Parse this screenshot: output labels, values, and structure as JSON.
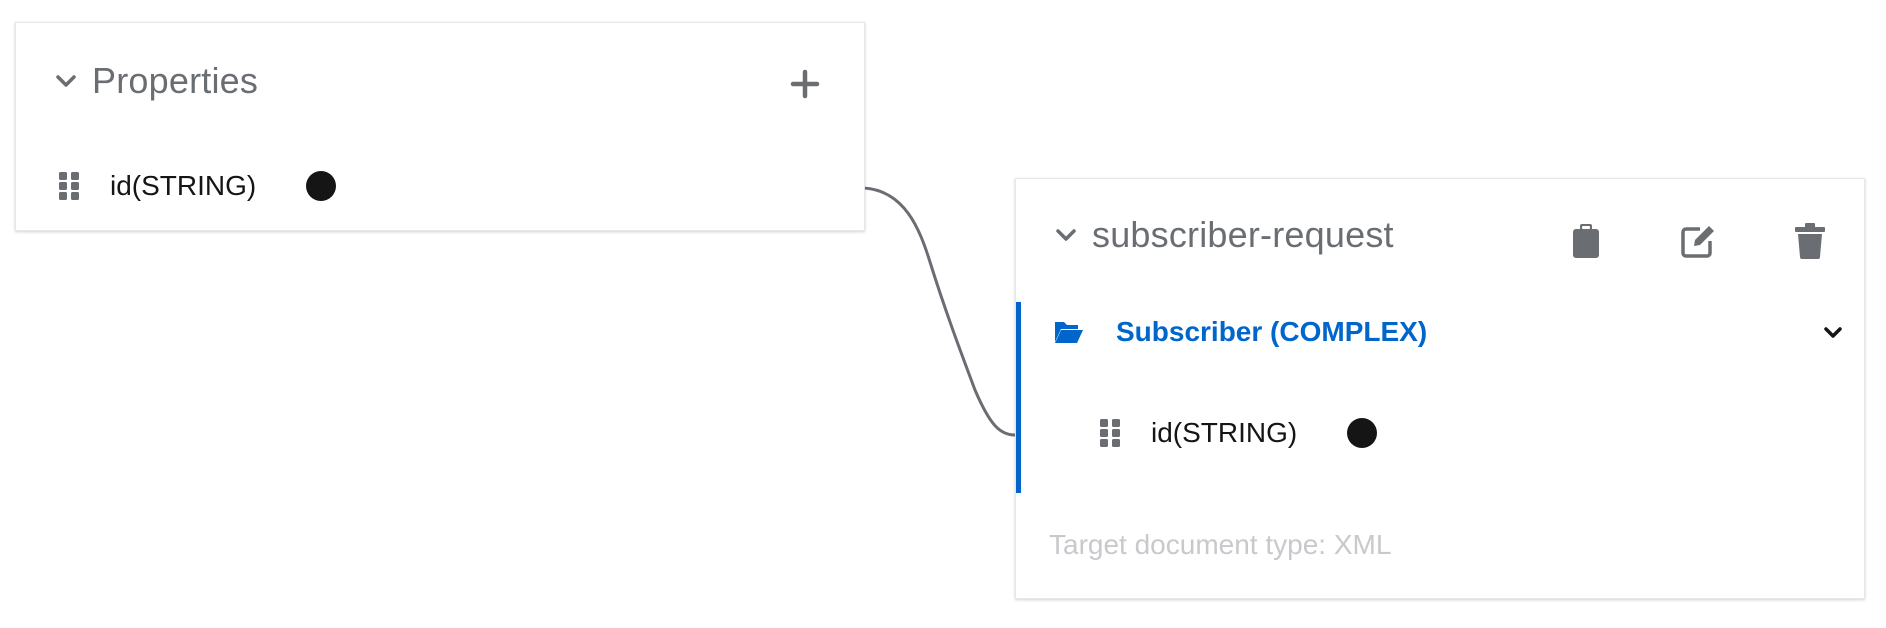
{
  "source_panel": {
    "title": "Properties",
    "add_icon": "plus-icon",
    "collapse_icon": "chevron-down-icon",
    "fields": [
      {
        "label": "id(STRING)",
        "drag_icon": "grip-icon",
        "mapped_indicator": "filled-circle"
      }
    ]
  },
  "target_panel": {
    "title": "subscriber-request",
    "collapse_icon": "chevron-down-icon",
    "actions": [
      {
        "name": "clipboard-icon"
      },
      {
        "name": "edit-icon"
      },
      {
        "name": "trash-icon"
      }
    ],
    "complex_field": {
      "label": "Subscriber (COMPLEX)",
      "icon": "folder-open-icon",
      "expand_icon": "chevron-down-icon",
      "children": [
        {
          "label": "id(STRING)",
          "drag_icon": "grip-icon",
          "mapped_indicator": "filled-circle"
        }
      ]
    },
    "document_type": "Target document type: XML"
  },
  "colors": {
    "accent": "#0066cc",
    "title_gray": "#6a6e73",
    "text": "#151515",
    "muted": "#c7c9cc",
    "connector": "#6a6e73"
  }
}
